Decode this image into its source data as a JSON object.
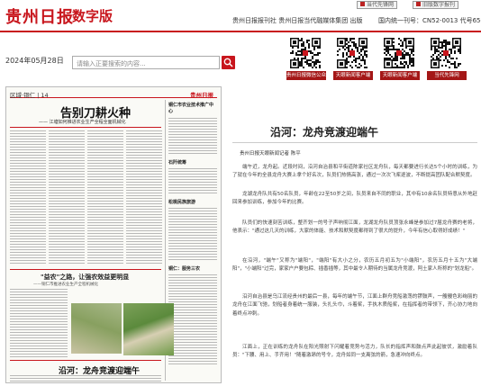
{
  "header": {
    "logo": "贵州日报",
    "logo_sub": "数字版",
    "publisher": "贵州日报报刊社 贵州日报当代融媒体集团 出版",
    "cn": "国内统一刊号：CN52-0013 代号65-1",
    "current_issue_btn": "当代先锋网",
    "past_issue_btn": "旧版数字报刊"
  },
  "toolbar": {
    "date": "2024年05月28日",
    "search_placeholder": "请输入正要搜索的内容..."
  },
  "qr_codes": [
    {
      "label": "贵州日报微信公众号"
    },
    {
      "label": "天眼新闻客户端"
    },
    {
      "label": "天眼新闻客户端"
    },
    {
      "label": "当代先锋网"
    }
  ],
  "newspaper": {
    "page_section": "区域·铜仁",
    "page_no": "14",
    "paper_name": "贵州日报",
    "headline": "告别刀耕火种",
    "subhead": "—— 江塘如何推进农业生产全程全面机械化",
    "side_headline": "铜仁市农业技术推广中心",
    "mid_headline": "\"益农\"之路，让强农效益更明显",
    "mid_subhead": "——铜仁市推进农业生产全程机械化",
    "right_col_1": "石阡统筹",
    "right_col_2": "松桃民族旅游",
    "right_col_3": "铜仁：服务三农",
    "bottom_headline": "沿河：龙舟竞渡迎端午"
  },
  "article": {
    "title": "沿河：龙舟竞渡迎端午",
    "byline": "贵州日报天眼新闻记者 陈平",
    "paragraphs": [
      "端午近，龙舟起。近段时间，沿河自治县和平街道陈家社区龙舟队，每天都要进行长达5个小时的训练，为了就在今年的全县龙舟大赛上拿个好名次，队员们热情高涨，通过一次次飞桨逐波，不断提高团队配合默契度。",
      "龙湖龙舟队共有50名队员，年龄在22至50岁之间，队员来自不同的职业，其中有10余名队员特意从外地赶回来参加训练，参加今年的比赛。",
      "队员们的快速刻苦训练，整齐划一的号子声响彻江面，龙湖龙舟队员顶张永峰是参加过7届龙舟赛的老将，他表示：\"通过这几天的训练，大家的体能、技术和默契度都得到了很大的提升，今年有信心取得好成绩！\"",
      "在沿河，\"端午\"又称为\"端阳\"，\"端阳\"有大小之分，农历五月初五为\"小端阳\"，农历五月十五为\"大端阳\"，\"小端阳\"过完，家家户户要包粽、插香插等，其中最令人期待的当属龙舟竞渡，阿土家人所称的\"划龙船\"。",
      "沿河自治县是乌江流经贵州的最后一县，每年的端午节，江面上群舟竞船激荡的锣鼓声，一艘艘色彩绚丽的龙舟在江面飞驰，划船者身着统一服装，头扎头巾，斗着桨，手执木质船桨，在指挥者的带领下，齐心协力地向着终点冲刺。",
      "江面上，正在训练的龙舟队在阳光照射下闪耀着竞势与活力，队长的指挥声和鼓点声此起彼伏，激励着队员：\"下腰、用上、手齐用！\"随着激昂的号令，龙舟如同一支离弦的箭，急速冲向终点。"
    ]
  },
  "colors": {
    "brand_red": "#c8161d",
    "qr_label_bg": "#a41717"
  }
}
